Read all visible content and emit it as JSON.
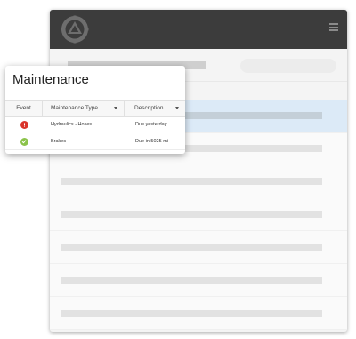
{
  "app": {
    "logo_icon": "gear-triangle-logo-icon",
    "menu_icon": "hamburger-icon",
    "header_color": "#3c3c3c",
    "selected_row_color": "#dceaf7"
  },
  "panel": {
    "title": "Maintenance",
    "columns": [
      {
        "label": "Event"
      },
      {
        "label": "Maintenance Type",
        "sort_icon": "caret-down-icon"
      },
      {
        "label": "Description",
        "sort_icon": "caret-down-icon"
      }
    ],
    "rows": [
      {
        "status": "alert",
        "status_color": "#d9342b",
        "status_icon": "alert-icon",
        "type": "Hydraulics - Hoses",
        "description": "Due yesterday"
      },
      {
        "status": "ok",
        "status_color": "#8bc34a",
        "status_icon": "check-icon",
        "type": "Brakes",
        "description": "Due in 5025 mi"
      }
    ]
  }
}
